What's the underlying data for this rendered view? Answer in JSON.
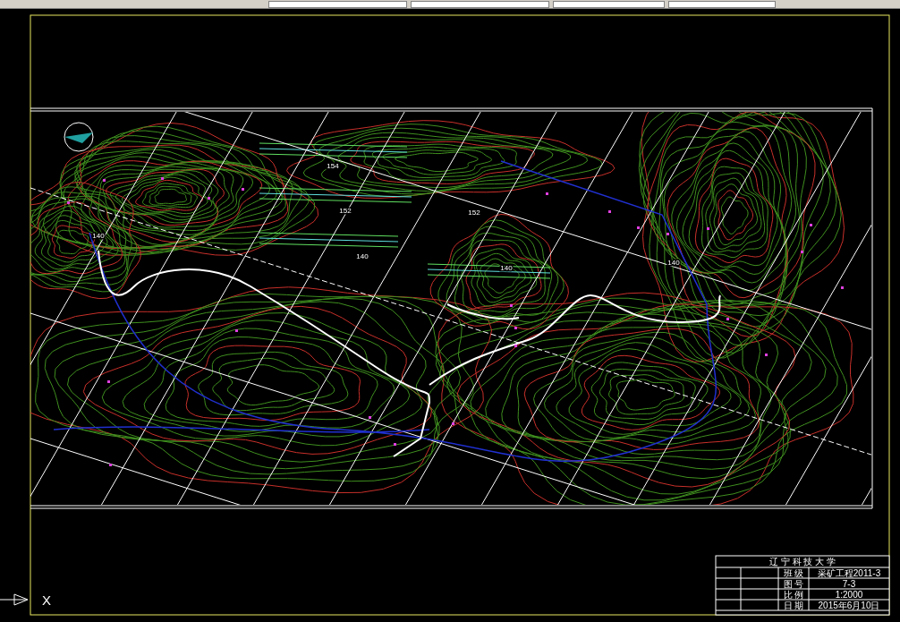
{
  "elevation_labels": [
    {
      "text": "154"
    },
    {
      "text": "152"
    },
    {
      "text": "152"
    },
    {
      "text": "140"
    },
    {
      "text": "140"
    },
    {
      "text": "140"
    },
    {
      "text": "140"
    }
  ],
  "title_block": {
    "header": "辽 宁 科 技 大 学",
    "rows": [
      [
        "",
        "",
        "班 级",
        "采矿工程2011-3"
      ],
      [
        "",
        "",
        "图 号",
        "7-3"
      ],
      [
        "",
        "",
        "比 例",
        "1:2000"
      ],
      [
        "",
        "",
        "日 期",
        "2015年6月10日"
      ]
    ]
  },
  "ucs_icon": {
    "axis_label": "X"
  }
}
